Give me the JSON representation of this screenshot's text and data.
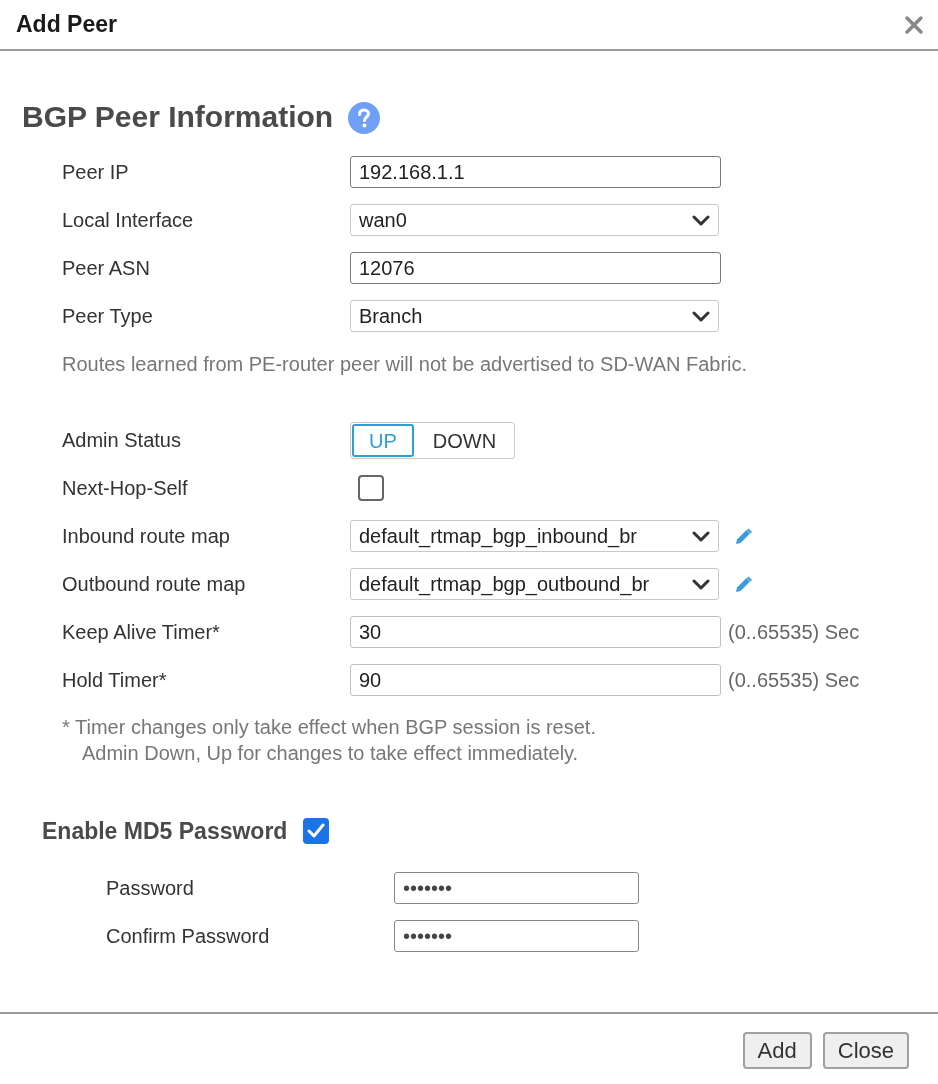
{
  "dialog": {
    "title": "Add Peer"
  },
  "section": {
    "title": "BGP Peer Information"
  },
  "fields": [
    {
      "kind": "text",
      "label": "Peer IP",
      "value": "192.168.1.1"
    },
    {
      "kind": "select",
      "label": "Local Interface",
      "value": "wan0"
    },
    {
      "kind": "text",
      "label": "Peer ASN",
      "value": "12076"
    },
    {
      "kind": "select",
      "label": "Peer Type",
      "value": "Branch"
    },
    {
      "kind": "note",
      "text": "Routes learned from PE-router peer will not be advertised to SD-WAN Fabric."
    },
    {
      "kind": "toggle",
      "label": "Admin Status",
      "options": [
        {
          "label": "UP",
          "selected": true
        },
        {
          "label": "DOWN",
          "selected": false
        }
      ]
    },
    {
      "kind": "checkbox",
      "label": "Next-Hop-Self",
      "checked": false
    },
    {
      "kind": "select_edit",
      "label": "Inbound route map",
      "value": "default_rtmap_bgp_inbound_br"
    },
    {
      "kind": "select_edit",
      "label": "Outbound route map",
      "value": "default_rtmap_bgp_outbound_br"
    },
    {
      "kind": "timer",
      "label": "Keep Alive Timer*",
      "value": "30",
      "suffix": "(0..65535) Sec"
    },
    {
      "kind": "timer",
      "label": "Hold Timer*",
      "value": "90",
      "suffix": "(0..65535) Sec"
    },
    {
      "kind": "footnote",
      "lines": [
        "* Timer changes only take effect when BGP session is reset.",
        "Admin Down, Up for changes to take effect immediately."
      ]
    }
  ],
  "md5": {
    "title": "Enable MD5 Password",
    "checked": true,
    "fields": [
      {
        "label": "Password",
        "value": "•••••••"
      },
      {
        "label": "Confirm Password",
        "value": "•••••••"
      }
    ]
  },
  "buttons": [
    {
      "label": "Add"
    },
    {
      "label": "Close"
    }
  ]
}
